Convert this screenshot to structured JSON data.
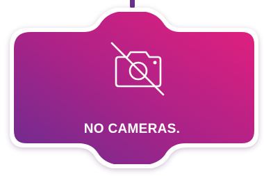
{
  "status": {
    "message": "NO CAMERAS.",
    "icon": "camera-off-icon"
  },
  "colors": {
    "gradient_start": "#6a2c91",
    "gradient_end": "#e61f7d",
    "border": "#ffffff",
    "cord": "#6b2f8e",
    "text": "#ffffff"
  }
}
